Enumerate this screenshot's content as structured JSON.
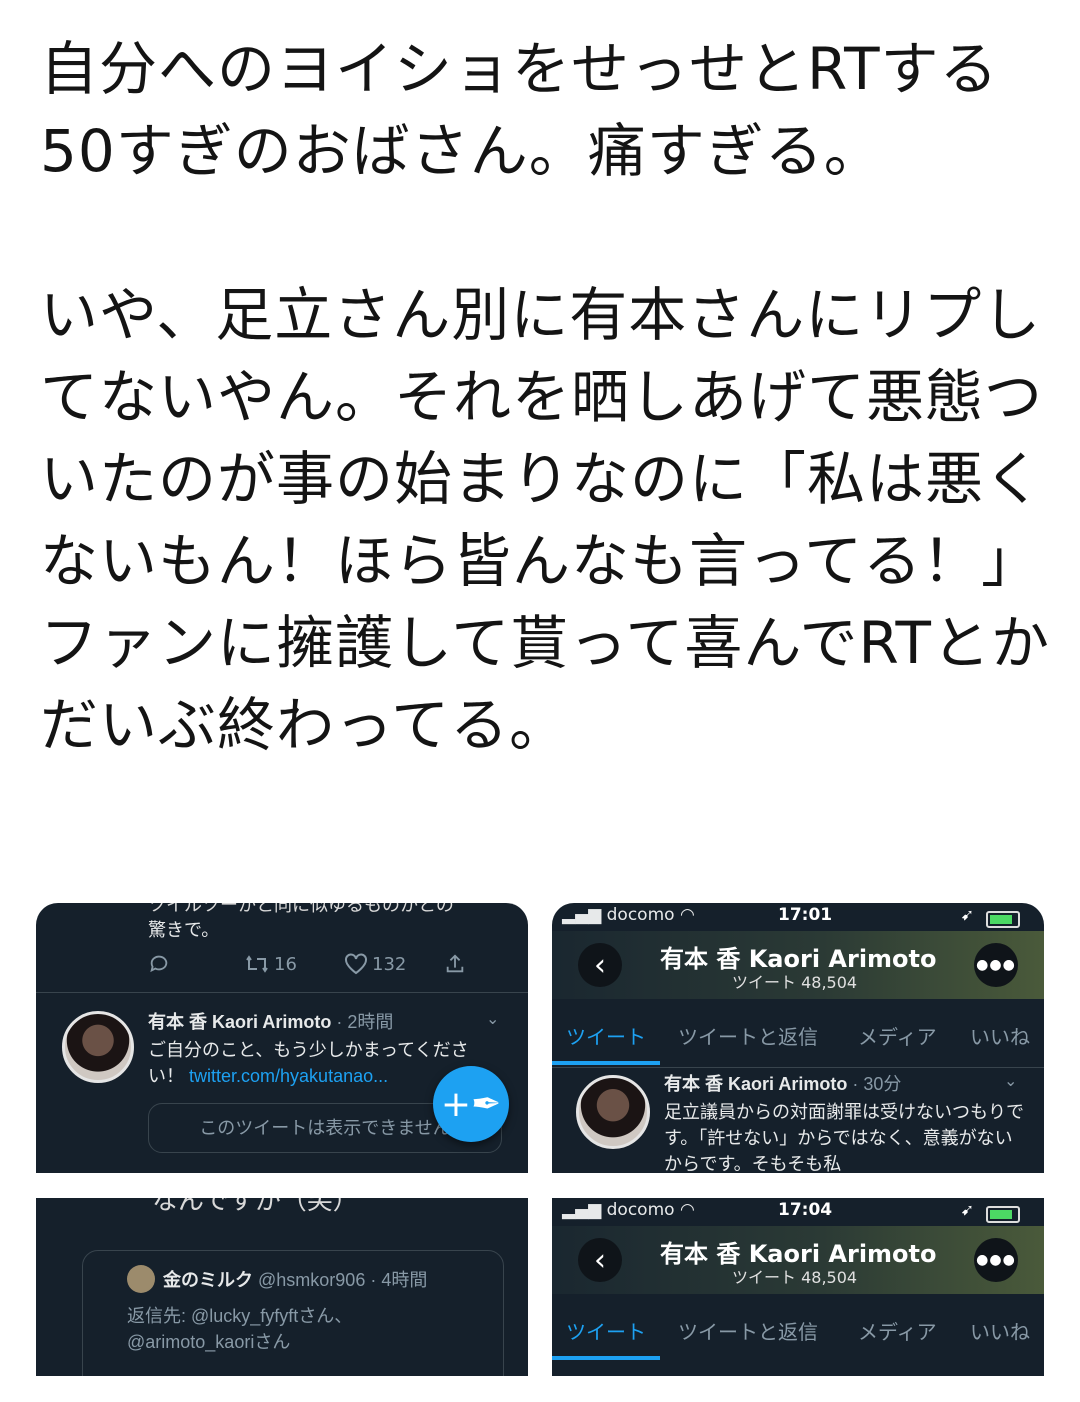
{
  "post": {
    "text": "自分へのヨイショをせっせとRTする50すぎのおばさん。痛すぎる。\n\nいや、足立さん別に有本さんにリプしてないやん。それを晒しあげて悪態ついたのが事の始まりなのに「私は悪くないもん！ほら皆んなも言ってる！」ファンに擁護して貰って喜んでRTとかだいぶ終わってる。"
  },
  "shot_top_left": {
    "cut_text": "ツイルツーかと同に似ゆるものかとの",
    "text1": "驚きで。",
    "actions": {
      "retweets": "16",
      "likes": "132"
    },
    "tweet": {
      "name": "有本 香 Kaori Arimoto",
      "time": "· 2時間",
      "body": "ご自分のこと、もう少しかまってください！ ",
      "link": "twitter.com/hyakutanao...",
      "quote_unavailable": "このツイートは表示できません"
    }
  },
  "shot_top_right": {
    "status": {
      "carrier": "docomo",
      "time": "17:01"
    },
    "profile": {
      "name": "有本 香 Kaori Arimoto",
      "tweet_count": "ツイート 48,504"
    },
    "tabs": [
      "ツイート",
      "ツイートと返信",
      "メディア",
      "いいね"
    ],
    "tweet": {
      "name": "有本 香 Kaori Arimoto",
      "time": "· 30分",
      "body": "足立議員からの対面謝罪は受けないつもりです。「許せない」からではなく、意義がないからです。そもそも私"
    }
  },
  "shot_bottom_left": {
    "cut_text": "なんですか（笑）",
    "card": {
      "name": "金のミルク",
      "handle": "@hsmkor906 · 4時間",
      "reply_prefix": "返信先: ",
      "reply_user1": "@lucky_fyfyft",
      "reply_mid": "さん、",
      "reply_user2": "@arimoto_kaori",
      "reply_suffix": "さん"
    }
  },
  "shot_bottom_right": {
    "status": {
      "carrier": "docomo",
      "time": "17:04"
    },
    "profile": {
      "name": "有本 香 Kaori Arimoto",
      "tweet_count": "ツイート 48,504"
    },
    "tabs": [
      "ツイート",
      "ツイートと返信",
      "メディア",
      "いいね"
    ]
  },
  "colors": {
    "accent": "#1da1f2",
    "dark_bg": "#15202b",
    "muted": "#8899a6"
  }
}
